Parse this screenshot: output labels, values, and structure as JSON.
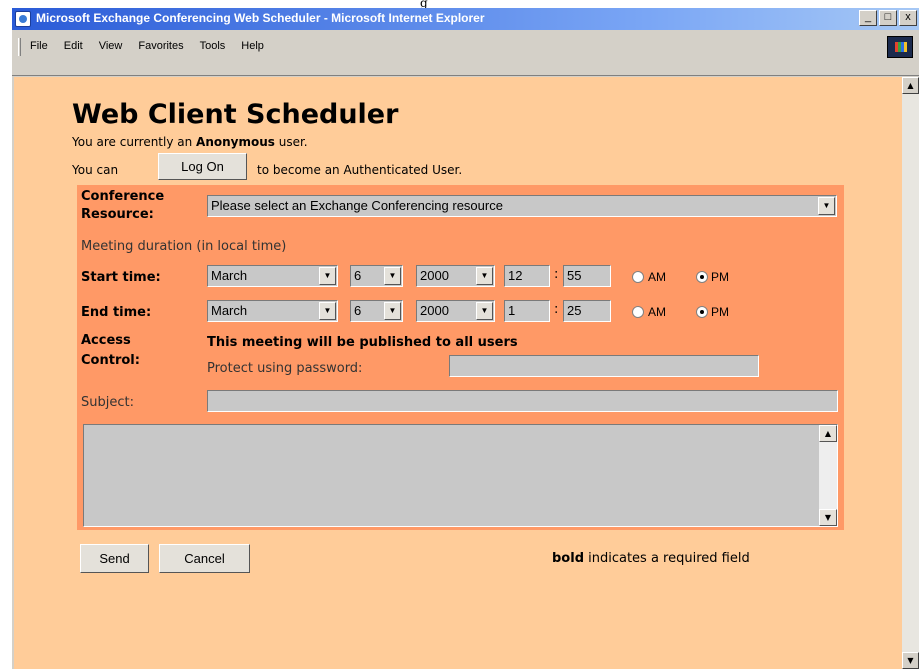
{
  "top_strip": {
    "text": "g"
  },
  "window": {
    "title": "Microsoft Exchange Conferencing Web Scheduler - Microsoft Internet Explorer",
    "controls": {
      "minimize": "_",
      "maximize": "□",
      "close": "x"
    }
  },
  "menu": [
    {
      "label": "File"
    },
    {
      "label": "Edit"
    },
    {
      "label": "View"
    },
    {
      "label": "Favorites"
    },
    {
      "label": "Tools"
    },
    {
      "label": "Help"
    }
  ],
  "page": {
    "title": "Web Client Scheduler",
    "status_prefix": "You are currently an ",
    "status_user": "Anonymous",
    "status_suffix": " user.",
    "logon_prefix": "You can",
    "logon_button": "Log On",
    "logon_suffix": "to become an Authenticated User."
  },
  "form": {
    "resource_label_1": "Conference",
    "resource_label_2": "Resource:",
    "resource_value": "Please select an Exchange Conferencing resource",
    "duration_label": "Meeting duration (in local time)",
    "start": {
      "label": "Start time:",
      "month": "March",
      "day": "6",
      "year": "2000",
      "hour": "12",
      "minute": "55",
      "period": "PM"
    },
    "end": {
      "label": "End time:",
      "month": "March",
      "day": "6",
      "year": "2000",
      "hour": "1",
      "minute": "25",
      "period": "PM"
    },
    "am_label": "AM",
    "pm_label": "PM",
    "access_label_1": "Access",
    "access_label_2": "Control:",
    "publish_note": "This meeting will be published to all users",
    "password_label": "Protect using password:",
    "password_value": "",
    "subject_label": "Subject:",
    "subject_value": "",
    "body_value": ""
  },
  "actions": {
    "send": "Send",
    "cancel": "Cancel",
    "required_bold": "bold",
    "required_rest": " indicates a required field"
  },
  "colors": {
    "page_bg": "#ffcc99",
    "form_bg": "#ff9966",
    "field_bg": "#c8c8c8",
    "titlebar": "#2a5bd7"
  }
}
